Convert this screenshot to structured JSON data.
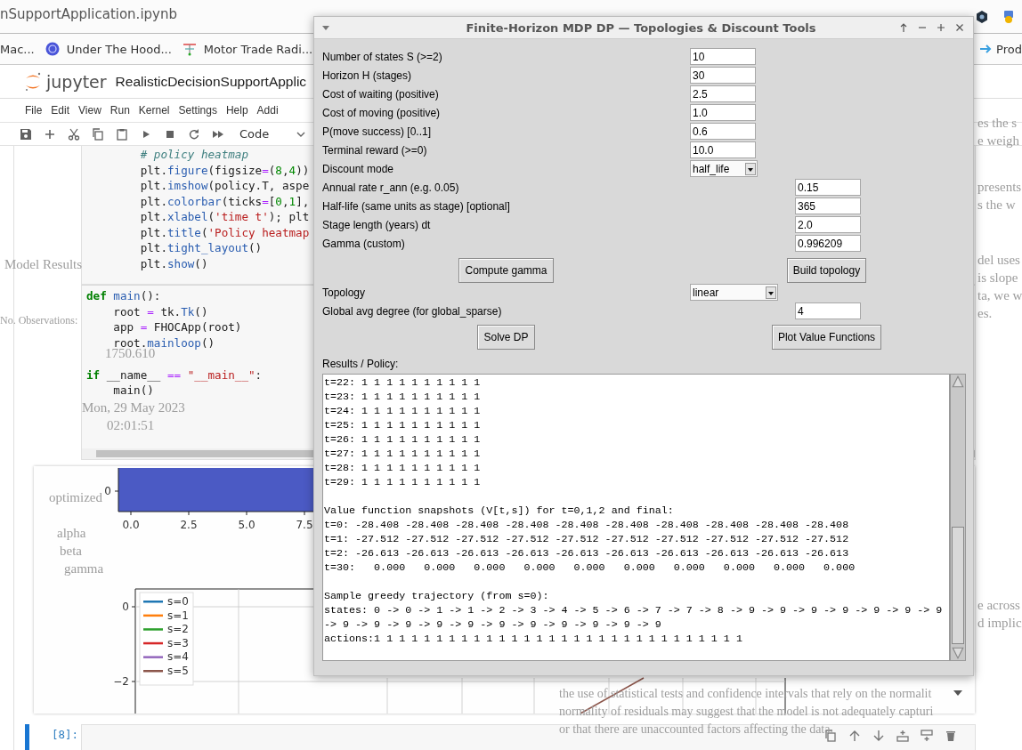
{
  "browser": {
    "tab_title": "nSupportApplication.ipynb",
    "bookmarks": [
      {
        "label": "Mac..."
      },
      {
        "label": "Under The Hood..."
      },
      {
        "label": "Motor Trade Radi..."
      },
      {
        "label": "Prod"
      }
    ]
  },
  "jupyter": {
    "logo_text": "jupyter",
    "notebook_title": "RealisticDecisionSupportApplic",
    "menu": [
      "File",
      "Edit",
      "View",
      "Run",
      "Kernel",
      "Settings",
      "Help",
      "Addi"
    ],
    "cell_type": "Code"
  },
  "cells": [
    {
      "blocks": [
        [
          [
            {
              "kind": "comment",
              "text": "        # policy heatmap"
            }
          ],
          [
            {
              "kind": "plain",
              "text": "        plt."
            },
            {
              "kind": "func",
              "text": "figure"
            },
            {
              "kind": "plain",
              "text": "(figsize"
            },
            {
              "kind": "op",
              "text": "="
            },
            {
              "kind": "plain",
              "text": "("
            },
            {
              "kind": "num",
              "text": "8"
            },
            {
              "kind": "plain",
              "text": ","
            },
            {
              "kind": "num",
              "text": "4"
            },
            {
              "kind": "plain",
              "text": "))"
            }
          ],
          [
            {
              "kind": "plain",
              "text": "        plt."
            },
            {
              "kind": "func",
              "text": "imshow"
            },
            {
              "kind": "plain",
              "text": "(policy.T, aspe"
            }
          ],
          [
            {
              "kind": "plain",
              "text": "        plt."
            },
            {
              "kind": "func",
              "text": "colorbar"
            },
            {
              "kind": "plain",
              "text": "(ticks"
            },
            {
              "kind": "op",
              "text": "="
            },
            {
              "kind": "plain",
              "text": "["
            },
            {
              "kind": "num",
              "text": "0"
            },
            {
              "kind": "plain",
              "text": ","
            },
            {
              "kind": "num",
              "text": "1"
            },
            {
              "kind": "plain",
              "text": "],"
            }
          ],
          [
            {
              "kind": "plain",
              "text": "        plt."
            },
            {
              "kind": "func",
              "text": "xlabel"
            },
            {
              "kind": "plain",
              "text": "("
            },
            {
              "kind": "str",
              "text": "'time t'"
            },
            {
              "kind": "plain",
              "text": "); plt"
            }
          ],
          [
            {
              "kind": "plain",
              "text": "        plt."
            },
            {
              "kind": "func",
              "text": "title"
            },
            {
              "kind": "plain",
              "text": "("
            },
            {
              "kind": "str",
              "text": "'Policy heatmap"
            }
          ],
          [
            {
              "kind": "plain",
              "text": "        plt."
            },
            {
              "kind": "func",
              "text": "tight_layout"
            },
            {
              "kind": "plain",
              "text": "()"
            }
          ],
          [
            {
              "kind": "plain",
              "text": "        plt."
            },
            {
              "kind": "func",
              "text": "show"
            },
            {
              "kind": "plain",
              "text": "()"
            }
          ]
        ]
      ]
    },
    {
      "blocks": [
        [
          [
            {
              "kind": "kw",
              "text": "def"
            },
            {
              "kind": "func",
              "text": " main"
            },
            {
              "kind": "plain",
              "text": "():"
            }
          ],
          [
            {
              "kind": "plain",
              "text": "    root "
            },
            {
              "kind": "op",
              "text": "="
            },
            {
              "kind": "plain",
              "text": " tk."
            },
            {
              "kind": "func",
              "text": "Tk"
            },
            {
              "kind": "plain",
              "text": "()"
            }
          ],
          [
            {
              "kind": "plain",
              "text": "    app "
            },
            {
              "kind": "op",
              "text": "="
            },
            {
              "kind": "plain",
              "text": " FHOCApp(root)"
            }
          ],
          [
            {
              "kind": "plain",
              "text": "    root."
            },
            {
              "kind": "func",
              "text": "mainloop"
            },
            {
              "kind": "plain",
              "text": "()"
            }
          ]
        ],
        [
          [
            {
              "kind": "kw",
              "text": "if"
            },
            {
              "kind": "plain",
              "text": " __name__ "
            },
            {
              "kind": "op",
              "text": "=="
            },
            {
              "kind": "str",
              "text": " \"__main__\""
            },
            {
              "kind": "plain",
              "text": ":"
            }
          ],
          [
            {
              "kind": "plain",
              "text": "    main()"
            }
          ]
        ]
      ]
    }
  ],
  "output": {
    "heatmap": {
      "color": "#4b5ac4",
      "ytick": "0",
      "xticks": [
        "0.0",
        "2.5",
        "5.0",
        "7.5"
      ]
    },
    "line_plot": {
      "yticks": [
        "0",
        "−2"
      ],
      "legend": [
        {
          "label": "s=0",
          "color": "#1f77b4"
        },
        {
          "label": "s=1",
          "color": "#ff7f0e"
        },
        {
          "label": "s=2",
          "color": "#2ca02c"
        },
        {
          "label": "s=3",
          "color": "#d62728"
        },
        {
          "label": "s=4",
          "color": "#9467bd"
        },
        {
          "label": "s=5",
          "color": "#8c564b"
        }
      ]
    }
  },
  "next_cell": {
    "prompt": "[8]:"
  },
  "overlay_text": [
    "Model Results",
    "No. Observations:",
    "1750.610",
    "Mon, 29 May 2023",
    "02:01:51",
    "optimized",
    "alpha",
    "beta",
    "gamma",
    "es the s",
    "e weigh",
    "presents",
    "s the w",
    "del uses",
    "is slope",
    "ta, we w",
    "es.",
    "e across",
    "d implic",
    "the use of statistical tests and confidence intervals that rely on the normalit",
    "normality of residuals may suggest that the model is not adequately capturi",
    "or that there are unaccounted factors affecting the data."
  ],
  "dialog": {
    "title": "Finite-Horizon MDP DP — Topologies & Discount Tools",
    "model_fields": [
      {
        "label": "Number of states S (>=2)",
        "value": "10",
        "kind": "entry"
      },
      {
        "label": "Horizon H (stages)",
        "value": "30",
        "kind": "entry"
      },
      {
        "label": "Cost of waiting (positive)",
        "value": "2.5",
        "kind": "entry"
      },
      {
        "label": "Cost of moving (positive)",
        "value": "1.0",
        "kind": "entry"
      },
      {
        "label": "P(move success) [0..1]",
        "value": "0.6",
        "kind": "entry"
      },
      {
        "label": "Terminal reward (>=0)",
        "value": "10.0",
        "kind": "entry"
      },
      {
        "label": "Discount mode",
        "value": "half_life",
        "kind": "dropdown"
      }
    ],
    "discount_fields": [
      {
        "label": "Annual rate r_ann (e.g. 0.05)",
        "value": "0.15",
        "kind": "entry"
      },
      {
        "label": "Half-life (same units as stage) [optional]",
        "value": "365",
        "kind": "entry"
      },
      {
        "label": "Stage length (years) dt",
        "value": "2.0",
        "kind": "entry"
      },
      {
        "label": "Gamma (custom)",
        "value": "0.996209",
        "kind": "entry"
      }
    ],
    "buttons_1": [
      "Compute gamma",
      "Build topology"
    ],
    "topology_fields": [
      {
        "label": "Topology",
        "value": "linear",
        "kind": "dropdown"
      },
      {
        "label": "Global avg degree (for global_sparse)",
        "value": "4",
        "kind": "entry"
      }
    ],
    "buttons_2": [
      "Solve DP",
      "Plot Value Functions"
    ],
    "results_label": "Results / Policy:",
    "results_blocks": [
      [
        "t=22: 1 1 1 1 1 1 1 1 1 1",
        "t=23: 1 1 1 1 1 1 1 1 1 1",
        "t=24: 1 1 1 1 1 1 1 1 1 1",
        "t=25: 1 1 1 1 1 1 1 1 1 1",
        "t=26: 1 1 1 1 1 1 1 1 1 1",
        "t=27: 1 1 1 1 1 1 1 1 1 1",
        "t=28: 1 1 1 1 1 1 1 1 1 1",
        "t=29: 1 1 1 1 1 1 1 1 1 1"
      ],
      [
        "Value function snapshots (V[t,s]) for t=0,1,2 and final:",
        "t=0: -28.408 -28.408 -28.408 -28.408 -28.408 -28.408 -28.408 -28.408 -28.408 -28.408",
        "t=1: -27.512 -27.512 -27.512 -27.512 -27.512 -27.512 -27.512 -27.512 -27.512 -27.512",
        "t=2: -26.613 -26.613 -26.613 -26.613 -26.613 -26.613 -26.613 -26.613 -26.613 -26.613",
        "t=30:   0.000   0.000   0.000   0.000   0.000   0.000   0.000   0.000   0.000   0.000"
      ],
      [
        "Sample greedy trajectory (from s=0):",
        "states: 0 -> 0 -> 1 -> 1 -> 2 -> 3 -> 4 -> 5 -> 6 -> 7 -> 7 -> 8 -> 9 -> 9 -> 9 -> 9 -> 9 -> 9 -> 9",
        "-> 9 -> 9 -> 9 -> 9 -> 9 -> 9 -> 9 -> 9 -> 9 -> 9 -> 9",
        "actions:1 1 1 1 1 1 1 1 1 1 1 1 1 1 1 1 1 1 1 1 1 1 1 1 1 1 1 1 1 1"
      ]
    ]
  }
}
